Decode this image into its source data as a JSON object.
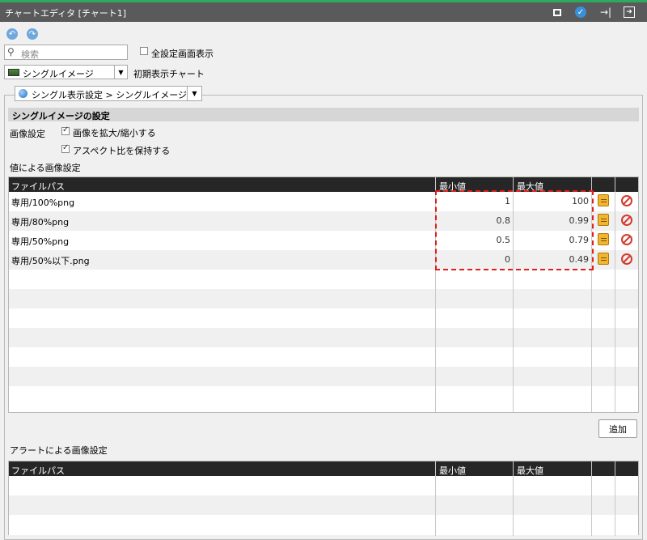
{
  "window": {
    "title": "チャートエディタ [チャート1]"
  },
  "toolbar": {
    "search_placeholder": "検索",
    "show_all_label": "全設定画面表示"
  },
  "initial_chart": {
    "selected": "シングルイメージ",
    "label": "初期表示チャート"
  },
  "display_setting": {
    "selected": "シングル表示設定 > シングルイメージ"
  },
  "single_image": {
    "section_title": "シングルイメージの設定",
    "image_setting_label": "画像設定",
    "scale_label": "画像を拡大/縮小する",
    "scale_checked": true,
    "aspect_label": "アスペクト比を保持する",
    "aspect_checked": true,
    "value_setting_label": "値による画像設定",
    "columns": [
      "ファイルパス",
      "最小値",
      "最大値"
    ],
    "rows": [
      {
        "path": "専用/100%png",
        "min": "1",
        "max": "100"
      },
      {
        "path": "専用/80%png",
        "min": "0.8",
        "max": "0.99"
      },
      {
        "path": "専用/50%png",
        "min": "0.5",
        "max": "0.79"
      },
      {
        "path": "専用/50%以下.png",
        "min": "0",
        "max": "0.49"
      }
    ],
    "add_label": "追加",
    "alert_setting_label": "アラートによる画像設定",
    "alert_columns": [
      "ファイルパス",
      "最小値",
      "最大値"
    ]
  },
  "colors": {
    "titlebar": "#5a5a5a",
    "accent_top": "#2eaa5e",
    "grid_header": "#262626",
    "highlight": "#e0201a"
  }
}
